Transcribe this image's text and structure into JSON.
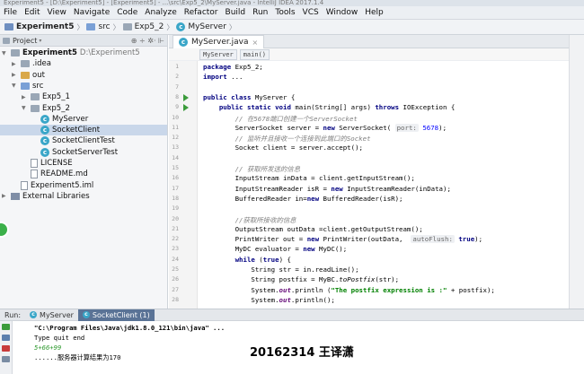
{
  "window": {
    "title": "Experiment5 - [D:\\Experiment5] - [Experiment5] - ...\\src\\Exp5_2\\MyServer.java - IntelliJ IDEA 2017.1.4"
  },
  "menu": [
    "File",
    "Edit",
    "View",
    "Navigate",
    "Code",
    "Analyze",
    "Refactor",
    "Build",
    "Run",
    "Tools",
    "VCS",
    "Window",
    "Help"
  ],
  "breadcrumb": [
    "Experiment5",
    "src",
    "Exp5_2",
    "MyServer"
  ],
  "project_panel": {
    "title": "Project",
    "tools": "⊕ ÷ ✲· ⊩",
    "tree": [
      {
        "label": "Experiment5",
        "extra": "D:\\Experiment5",
        "icon": "folder",
        "indent": 0,
        "arrow": "▼"
      },
      {
        "label": ".idea",
        "icon": "folder",
        "indent": 1,
        "arrow": "▶"
      },
      {
        "label": "out",
        "icon": "folder-yellow",
        "indent": 1,
        "arrow": "▶"
      },
      {
        "label": "src",
        "icon": "folder-src",
        "indent": 1,
        "arrow": "▼"
      },
      {
        "label": "Exp5_1",
        "icon": "package",
        "indent": 2,
        "arrow": "▶"
      },
      {
        "label": "Exp5_2",
        "icon": "package",
        "indent": 2,
        "arrow": "▼"
      },
      {
        "label": "MyServer",
        "icon": "class",
        "indent": 3,
        "arrow": ""
      },
      {
        "label": "SocketClient",
        "icon": "class",
        "indent": 3,
        "arrow": "",
        "selected": true
      },
      {
        "label": "SocketClientTest",
        "icon": "class",
        "indent": 3,
        "arrow": ""
      },
      {
        "label": "SocketServerTest",
        "icon": "class",
        "indent": 3,
        "arrow": ""
      },
      {
        "label": "LICENSE",
        "icon": "file",
        "indent": 2,
        "arrow": ""
      },
      {
        "label": "README.md",
        "icon": "file",
        "indent": 2,
        "arrow": ""
      },
      {
        "label": "Experiment5.iml",
        "icon": "file",
        "indent": 1,
        "arrow": ""
      },
      {
        "label": "External Libraries",
        "icon": "lib",
        "indent": 0,
        "arrow": "▶"
      }
    ]
  },
  "editor": {
    "tab": "MyServer.java",
    "bread": [
      "MyServer",
      "main()"
    ],
    "lines": [
      {
        "n": "1",
        "html": "<span class='kw'>package</span> Exp5_2;"
      },
      {
        "n": "2",
        "html": "<span class='kw'>import</span> ..."
      },
      {
        "n": "7",
        "html": ""
      },
      {
        "n": "8",
        "html": "<span class='kw'>public class</span> MyServer {",
        "run": true
      },
      {
        "n": "9",
        "html": "    <span class='kw'>public static void</span> main(String[] args) <span class='kw'>throws</span> IOException {",
        "run": true
      },
      {
        "n": "10",
        "html": "        <span class='cm'>// 在5678端口创建一个ServerSocket</span>"
      },
      {
        "n": "11",
        "html": "        ServerSocket server = <span class='kw'>new</span> ServerSocket( <span class='hint'>port:</span> <span style='color:#0000ff'>5678</span>);"
      },
      {
        "n": "12",
        "html": "        <span class='cm'>// 监听并且接收一个连接到此端口的Socket</span>"
      },
      {
        "n": "13",
        "html": "        Socket client = server.accept();"
      },
      {
        "n": "14",
        "html": ""
      },
      {
        "n": "15",
        "html": "        <span class='cm'>// 获取所发送的信息</span>"
      },
      {
        "n": "16",
        "html": "        InputStream inData = client.getInputStream();"
      },
      {
        "n": "17",
        "html": "        InputStreamReader isR = <span class='kw'>new</span> InputStreamReader(inData);"
      },
      {
        "n": "18",
        "html": "        BufferedReader in=<span class='kw'>new</span> BufferedReader(isR);"
      },
      {
        "n": "19",
        "html": ""
      },
      {
        "n": "20",
        "html": "        <span class='cm'>//获取所接收的信息</span>"
      },
      {
        "n": "21",
        "html": "        OutputStream outData =client.getOutputStream();"
      },
      {
        "n": "22",
        "html": "        PrintWriter out = <span class='kw'>new</span> PrintWriter(outData,  <span class='hint'>autoFlush:</span> <span class='kw'>true</span>);"
      },
      {
        "n": "23",
        "html": "        MyDC evaluator = <span class='kw'>new</span> MyDC();"
      },
      {
        "n": "24",
        "html": "        <span class='kw'>while</span> (<span class='kw'>true</span>) {"
      },
      {
        "n": "25",
        "html": "            String str = in.readLine();"
      },
      {
        "n": "26",
        "html": "            String postfix = MyBC.<span class='it'>toPostfix</span>(str);"
      },
      {
        "n": "27",
        "html": "            System.<span class='it' style='color:#660e7a;font-weight:bold'>out</span>.println (<span class='str'>\"The postfix expression is :\"</span> + postfix);"
      },
      {
        "n": "28",
        "html": "            System.<span class='it' style='color:#660e7a;font-weight:bold'>out</span>.println();"
      }
    ]
  },
  "run_panel": {
    "label": "Run:",
    "tabs": [
      "MyServer",
      "SocketClient (1)"
    ],
    "lines": [
      {
        "text": "\"C:\\Program Files\\Java\\jdk1.8.0_121\\bin\\java\" ...",
        "cls": "con-cmd"
      },
      {
        "text": "Type quit end",
        "cls": "con-out"
      },
      {
        "text": "5+66+99",
        "cls": "con-in"
      },
      {
        "text": "......服务器计算结果为170",
        "cls": "con-out"
      }
    ]
  },
  "watermark": "20162314 王译潇"
}
